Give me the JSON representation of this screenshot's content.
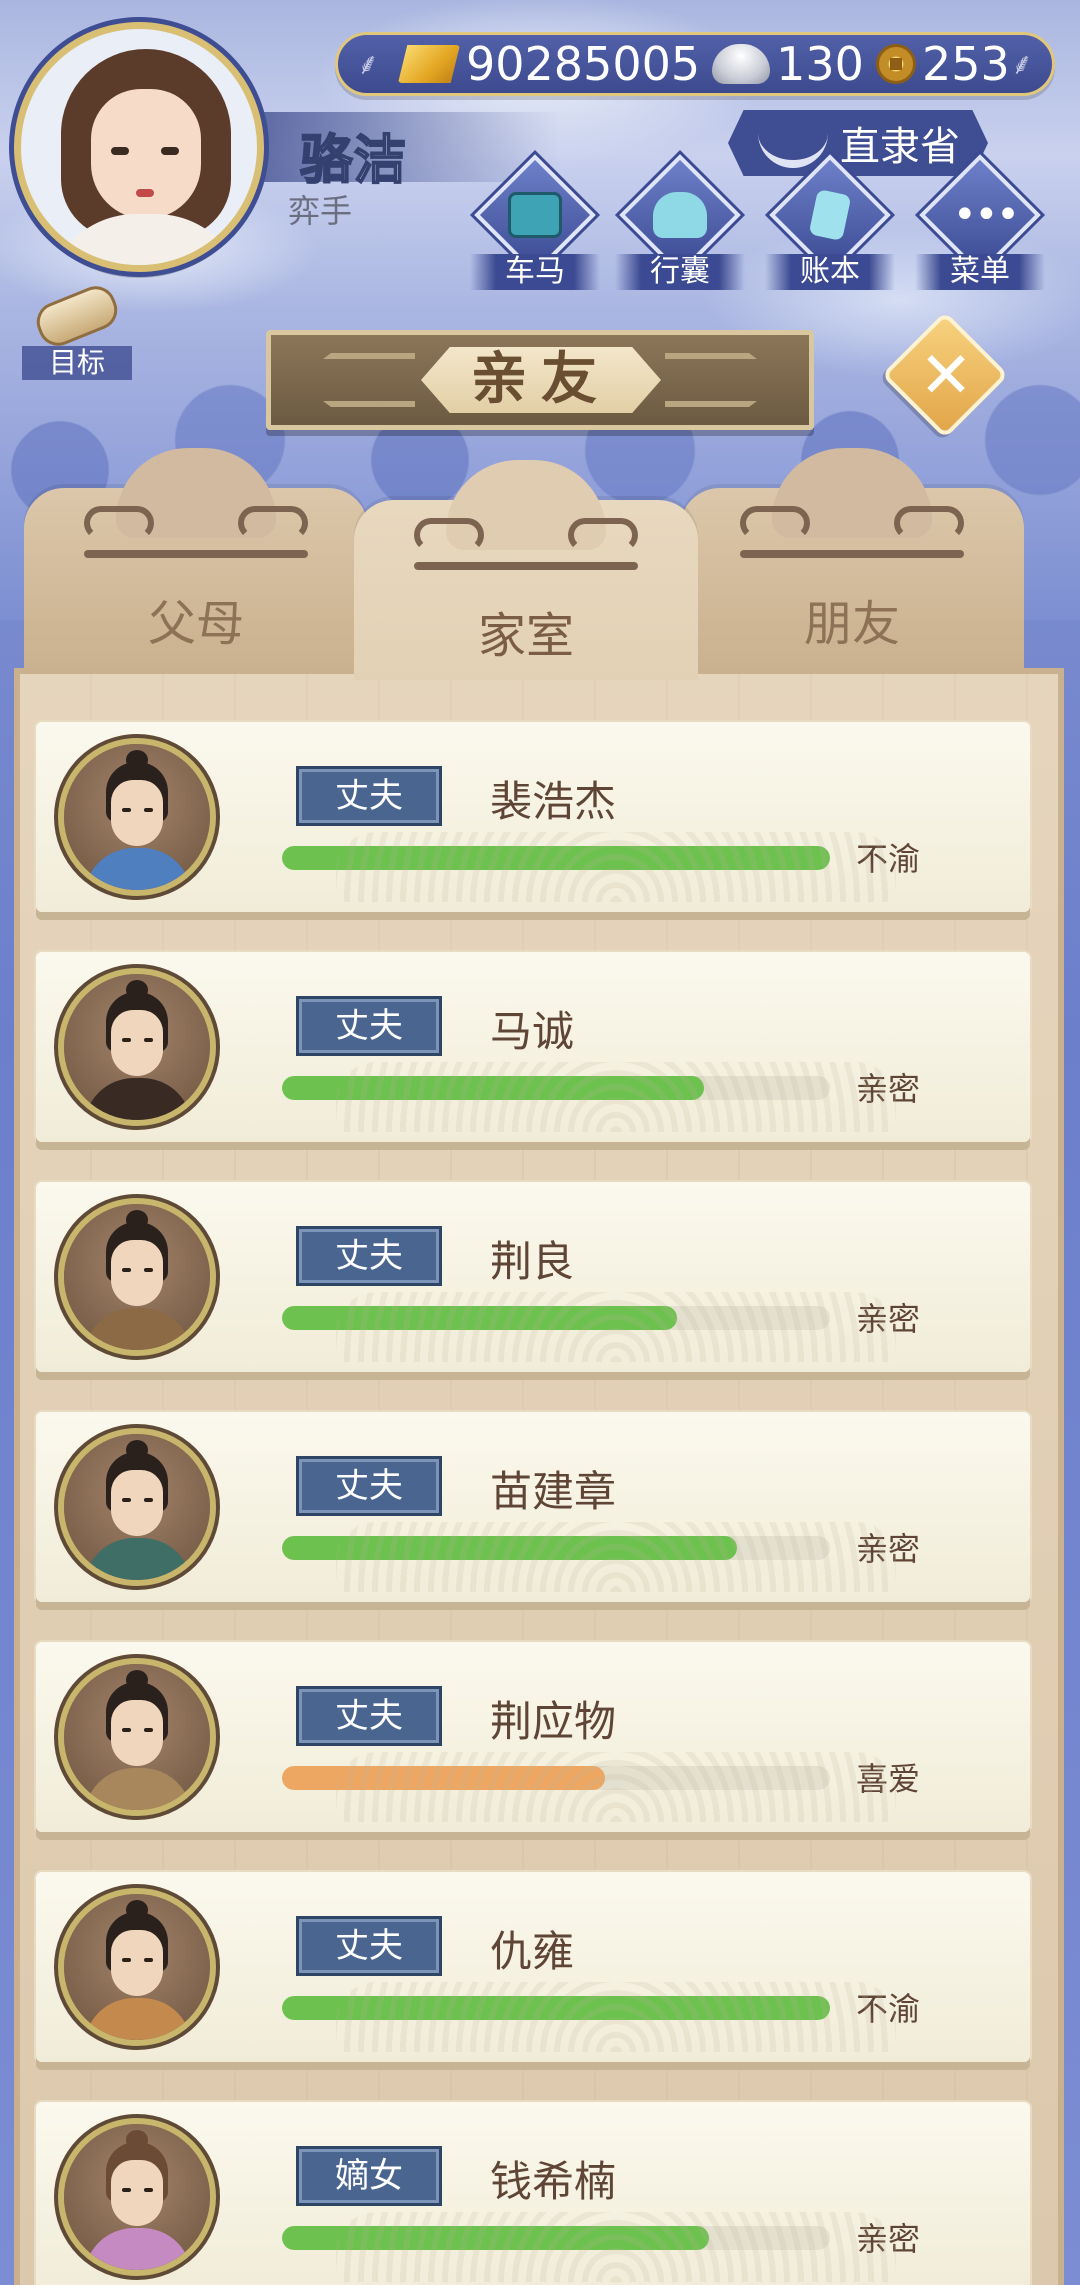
{
  "header": {
    "currencies": [
      {
        "icon": "gold-bar-icon",
        "value": "90285005"
      },
      {
        "icon": "silver-ingot-icon",
        "value": "130"
      },
      {
        "icon": "copper-coin-icon",
        "value": "253"
      }
    ],
    "player_name": "骆洁",
    "player_title": "弈手",
    "location": "直隶省",
    "nav": [
      {
        "label": "车马",
        "icon": "carriage-icon"
      },
      {
        "label": "行囊",
        "icon": "bundle-icon"
      },
      {
        "label": "账本",
        "icon": "ledger-icon"
      },
      {
        "label": "菜单",
        "icon": "menu-dots-icon"
      }
    ],
    "goal_label": "目标"
  },
  "page_title": "亲友",
  "close_symbol": "✕",
  "tabs": [
    {
      "label": "父母",
      "active": false
    },
    {
      "label": "家室",
      "active": true
    },
    {
      "label": "朋友",
      "active": false
    }
  ],
  "colors": {
    "bar_green": "#6cc14f",
    "bar_orange": "#eda763",
    "badge_blue": "#4a6590"
  },
  "relations": [
    {
      "role": "丈夫",
      "name": "裴浩杰",
      "mood": "不渝",
      "affection": 1.0,
      "bar_color": "#6cc14f"
    },
    {
      "role": "丈夫",
      "name": "马诚",
      "mood": "亲密",
      "affection": 0.77,
      "bar_color": "#6cc14f"
    },
    {
      "role": "丈夫",
      "name": "荆良",
      "mood": "亲密",
      "affection": 0.72,
      "bar_color": "#6cc14f"
    },
    {
      "role": "丈夫",
      "name": "苗建章",
      "mood": "亲密",
      "affection": 0.83,
      "bar_color": "#6cc14f"
    },
    {
      "role": "丈夫",
      "name": "荆应物",
      "mood": "喜爱",
      "affection": 0.59,
      "bar_color": "#eda763"
    },
    {
      "role": "丈夫",
      "name": "仇雍",
      "mood": "不渝",
      "affection": 1.0,
      "bar_color": "#6cc14f"
    },
    {
      "role": "嫡女",
      "name": "钱希楠",
      "mood": "亲密",
      "affection": 0.78,
      "bar_color": "#6cc14f"
    }
  ]
}
